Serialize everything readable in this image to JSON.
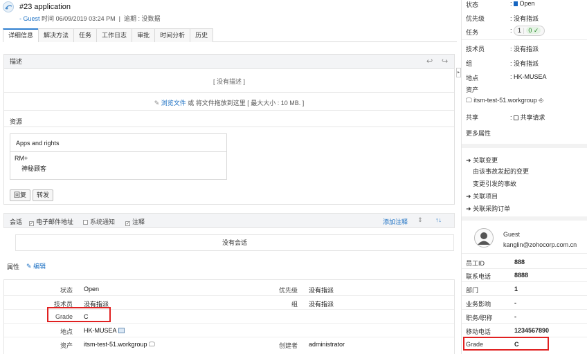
{
  "header": {
    "title": "#23 application",
    "requester": "- Guest",
    "time_label": "时间",
    "time_value": "06/09/2019 03:24 PM",
    "sep": "|",
    "overdue_label": "逾期 : 没数据"
  },
  "tabs": [
    "详细信息",
    "解决方法",
    "任务",
    "工作日志",
    "审批",
    "时间分析",
    "历史"
  ],
  "description": {
    "heading": "描述",
    "empty": "[ 没有描述 ]",
    "attach_link": "浏览文件",
    "attach_text": "或 将文件拖放到这里 [ 最大大小 : 10 MB. ]"
  },
  "resources": {
    "heading": "资源",
    "box_title": "Apps and rights",
    "item": "RM+",
    "subitem": "神秘顾客"
  },
  "actions": {
    "reply": "回复",
    "forward": "转发"
  },
  "conversation": {
    "label": "会话",
    "email": "电子邮件地址",
    "system": "系统通知",
    "notes": "注释",
    "add_note": "添加注释",
    "empty": "没有会话"
  },
  "properties": {
    "heading": "属性",
    "edit": "编辑",
    "rows": [
      {
        "l1": "状态",
        "v1": "Open",
        "l2": "优先级",
        "v2": "没有指派"
      },
      {
        "l1": "技术员",
        "v1": "没有指派",
        "l2": "组",
        "v2": "没有指派"
      },
      {
        "l1": "Grade",
        "v1": "C",
        "l2": "",
        "v2": ""
      },
      {
        "l1": "地点",
        "v1": "HK-MUSEA",
        "l2": "",
        "v2": ""
      },
      {
        "l1": "资产",
        "v1": "itsm-test-51.workgroup",
        "l2": "创建者",
        "v2": "administrator"
      }
    ]
  },
  "sidebar": {
    "status_label": "状态",
    "status_value": "Open",
    "status_color": "#1565c0",
    "priority_label": "优先级",
    "priority_value": ": 没有指派",
    "task_label": "任务",
    "task_count": "1",
    "task_done": "0",
    "tech_label": "技术员",
    "tech_value": ": 没有指派",
    "group_label": "组",
    "group_value": ": 没有指派",
    "site_label": "地点",
    "site_value": ": HK-MUSEA",
    "asset_label": "资产",
    "asset_value": "itsm-test-51.workgroup",
    "share_label": "共享",
    "share_value": "共享请求",
    "more": "更多属性",
    "links": [
      "关联变更",
      "由该事故发起的变更",
      "变更引发的事故",
      "关联项目",
      "关联采购订单"
    ],
    "user_name": "Guest",
    "user_email": "kanglin@zohocorp.com.cn",
    "fields": [
      {
        "label": "员工ID",
        "value": "888"
      },
      {
        "label": "联系电话",
        "value": "8888"
      },
      {
        "label": "部门",
        "value": "1"
      },
      {
        "label": "业务影响",
        "value": "-"
      },
      {
        "label": "职务/职称",
        "value": "-"
      },
      {
        "label": "移动电话",
        "value": "1234567890"
      },
      {
        "label": "Grade",
        "value": "C"
      }
    ]
  }
}
